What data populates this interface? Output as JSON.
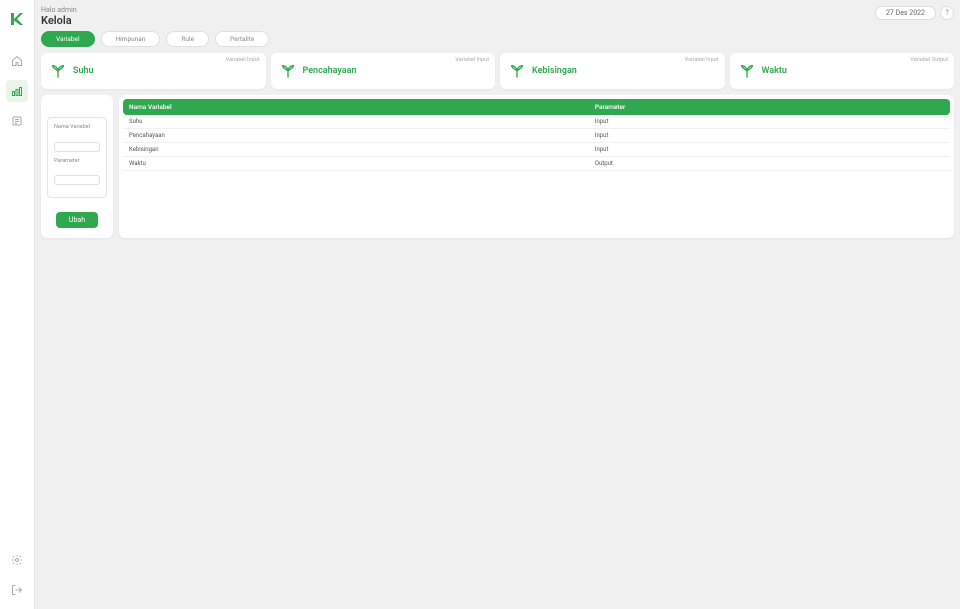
{
  "header": {
    "greeting": "Halo admin",
    "title": "Kelola",
    "date": "27 Des 2022"
  },
  "sidebar": {
    "items": [
      "home",
      "kelola",
      "list"
    ],
    "bottom_items": [
      "settings",
      "logout"
    ]
  },
  "sub_tabs": [
    {
      "label": "Variabel",
      "active": true
    },
    {
      "label": "Himpunan",
      "active": false
    },
    {
      "label": "Rule",
      "active": false
    },
    {
      "label": "Pertalite",
      "active": false
    }
  ],
  "variable_cards": [
    {
      "tag": "Variabel Input",
      "name": "Suhu"
    },
    {
      "tag": "Variabel Input",
      "name": "Pencahayaan"
    },
    {
      "tag": "Variabel Input",
      "name": "Kebisingan"
    },
    {
      "tag": "Variabel Output",
      "name": "Waktu"
    }
  ],
  "form": {
    "field1_label": "Nama Variabel",
    "field1_value": "",
    "field2_label": "Parameter",
    "field2_value": "",
    "submit_label": "Ubah"
  },
  "table": {
    "headers": [
      "Nama Variabel",
      "Parameter"
    ],
    "rows": [
      [
        "Suhu",
        "Input"
      ],
      [
        "Pencahayaan",
        "Input"
      ],
      [
        "Kebisingan",
        "Input"
      ],
      [
        "Waktu",
        "Output"
      ]
    ]
  }
}
